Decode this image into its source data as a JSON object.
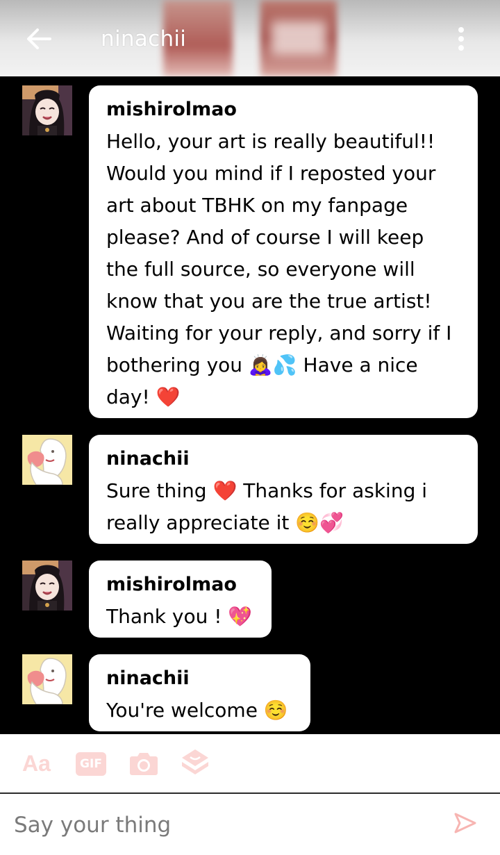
{
  "header": {
    "title": "ninachii",
    "back_icon": "arrow-left-icon",
    "more_icon": "more-vertical-icon"
  },
  "messages": [
    {
      "sender": "mishirolmao",
      "text": "Hello, your art is really beautiful!! Would you mind if I reposted your art about TBHK on my fanpage please? And of course I will keep the full source, so everyone will know that you are the true artist! Waiting for your reply, and sorry if I bothering you 🙇‍♀️💦 Have a nice day! ❤️"
    },
    {
      "sender": "ninachii",
      "text": "Sure thing ❤️ Thanks for asking i really appreciate it ☺️💞"
    },
    {
      "sender": "mishirolmao",
      "text": "Thank you ! 💖"
    },
    {
      "sender": "ninachii",
      "text": "You're welcome ☺️"
    }
  ],
  "toolbar": {
    "text_format_label": "Aa",
    "gif_label": "GIF",
    "camera_icon": "camera-icon",
    "sticker_icon": "sticker-icon"
  },
  "composer": {
    "placeholder": "Say your thing",
    "send_icon": "send-icon"
  },
  "colors": {
    "background": "#000000",
    "bubble": "#ffffff",
    "toolbar_icon_tint": "#fbd6d4"
  }
}
